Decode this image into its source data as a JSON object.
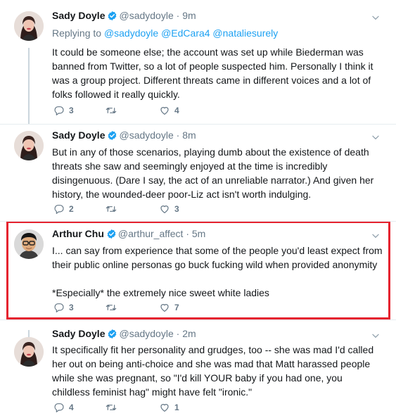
{
  "tweets": [
    {
      "name": "Sady Doyle",
      "handle": "@sadydoyle",
      "time": "· 9m",
      "replying_prefix": "Replying to",
      "replying_mentions": "@sadydoyle @EdCara4 @nataliesurely",
      "text": "It could be someone else; the account was set up while Biederman was banned from Twitter, so a lot of people suspected him. Personally I think it was a group project. Different threats came in different voices and a lot of folks followed it really quickly.",
      "replies": "3",
      "retweets": "",
      "likes": "4"
    },
    {
      "name": "Sady Doyle",
      "handle": "@sadydoyle",
      "time": "· 8m",
      "text": "But in any of those scenarios, playing dumb about the existence of death threats she saw and seemingly enjoyed at the time is incredibly disingenuous. (Dare I say, the act of an unreliable narrator.) And given her history, the wounded-deer poor-Liz act isn't worth indulging.",
      "replies": "2",
      "retweets": "",
      "likes": "3"
    },
    {
      "name": "Arthur Chu",
      "handle": "@arthur_affect",
      "time": "· 5m",
      "text_p1": "I... can say from experience that some of the people you'd least expect from their public online personas go buck fucking wild when provided anonymity",
      "text_p2": "*Especially* the extremely nice sweet white ladies",
      "replies": "3",
      "retweets": "",
      "likes": "7"
    },
    {
      "name": "Sady Doyle",
      "handle": "@sadydoyle",
      "time": "· 2m",
      "text": "It specifically fit her personality and grudges, too -- she was mad I'd called her out on being anti-choice and she was mad that Matt harassed people while she was pregnant, so \"I'd kill YOUR baby if you had one, you childless feminist hag\" might have felt \"ironic.\"",
      "replies": "4",
      "retweets": "",
      "likes": "1"
    }
  ],
  "icons": {
    "reply": "reply-icon",
    "retweet": "retweet-icon",
    "like": "heart-icon",
    "verified": "verified-badge-icon",
    "more": "chevron-down-icon"
  },
  "colors": {
    "link": "#1da1f2",
    "muted": "#657786",
    "highlight": "#e5232f"
  }
}
